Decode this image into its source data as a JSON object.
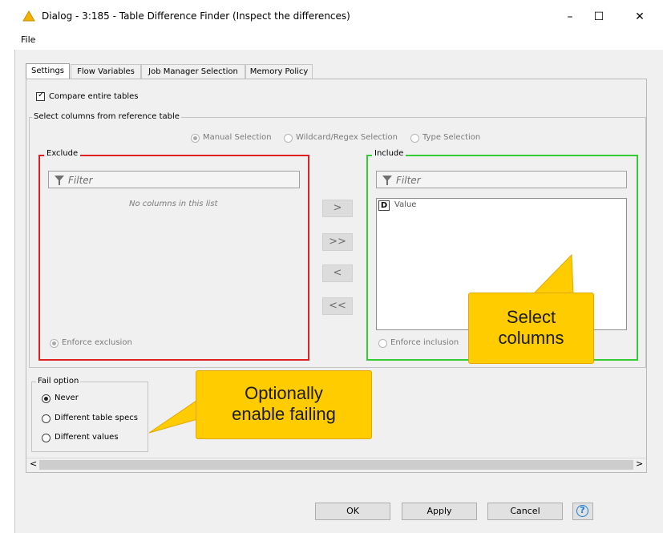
{
  "window": {
    "title": "Dialog - 3:185 - Table Difference Finder (Inspect the differences)",
    "controls": {
      "minimize": "–",
      "maximize": "☐",
      "close": "✕"
    }
  },
  "menu": {
    "file": "File"
  },
  "tabs": [
    {
      "label": "Settings",
      "active": true
    },
    {
      "label": "Flow Variables"
    },
    {
      "label": "Job Manager Selection"
    },
    {
      "label": "Memory Policy"
    }
  ],
  "settings": {
    "compare_entire_tables": {
      "label": "Compare entire tables",
      "checked": true
    },
    "select_columns_group": "Select columns from reference table",
    "selection_modes": [
      "Manual Selection",
      "Wildcard/Regex Selection",
      "Type Selection"
    ],
    "exclude": {
      "title": "Exclude",
      "filter_placeholder": "Filter",
      "empty_message": "No columns in this list",
      "enforce_label": "Enforce exclusion",
      "border_color": "#e02020"
    },
    "include": {
      "title": "Include",
      "filter_placeholder": "Filter",
      "items": [
        {
          "type_badge": "D",
          "name": "Value"
        }
      ],
      "enforce_label": "Enforce inclusion",
      "border_color": "#33cc33"
    },
    "move_buttons": [
      ">",
      ">>",
      "<",
      "<<"
    ],
    "fail_option": {
      "title": "Fail option",
      "options": [
        "Never",
        "Different table specs",
        "Different values"
      ],
      "selected": "Never"
    }
  },
  "scrollbar": {
    "left_arrow": "<",
    "right_arrow": ">"
  },
  "callouts": {
    "select_columns": "Select columns",
    "select_columns_line1": "Select",
    "select_columns_line2": "columns",
    "failing_line1": "Optionally",
    "failing_line2": "enable failing",
    "color": "#ffcc00"
  },
  "buttons": {
    "ok": "OK",
    "apply": "Apply",
    "cancel": "Cancel",
    "help": "?"
  }
}
